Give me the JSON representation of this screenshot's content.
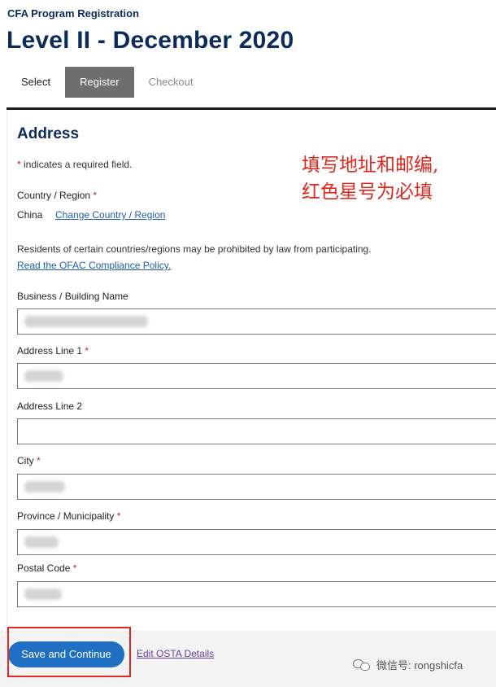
{
  "header": {
    "program_label": "CFA Program Registration",
    "title": "Level II - December 2020"
  },
  "tabs": [
    {
      "label": "Select",
      "state": "completed"
    },
    {
      "label": "Register",
      "state": "active"
    },
    {
      "label": "Checkout",
      "state": "disabled"
    }
  ],
  "form": {
    "section_title": "Address",
    "required_marker": "*",
    "required_note": "indicates a required field.",
    "country": {
      "label": "Country / Region",
      "value": "China",
      "change_link": "Change Country / Region"
    },
    "residents_note": "Residents of certain countries/regions may be prohibited by law from participating.",
    "ofac_link": "Read the OFAC Compliance Policy.",
    "fields": {
      "building": {
        "label": "Business / Building Name",
        "required": false,
        "value": ""
      },
      "address1": {
        "label": "Address Line 1",
        "required": true,
        "value": ""
      },
      "address2": {
        "label": "Address Line 2",
        "required": false,
        "value": ""
      },
      "city": {
        "label": "City",
        "required": true,
        "value": ""
      },
      "province": {
        "label": "Province / Municipality",
        "required": true,
        "value": ""
      },
      "postal": {
        "label": "Postal Code",
        "required": true,
        "value": ""
      }
    }
  },
  "annotation": {
    "line1": "填写地址和邮编,",
    "line2": "红色星号为必填"
  },
  "footer": {
    "save_button": "Save and Continue",
    "edit_link": "Edit OSTA Details"
  },
  "watermark": {
    "text": "微信号: rongshicfa"
  },
  "colors": {
    "brand_navy": "#0b2c5a",
    "link_blue": "#1f5fa8",
    "button_blue": "#1f6fc2",
    "required_red": "#c1272d",
    "annotation_red": "#e0261d"
  }
}
